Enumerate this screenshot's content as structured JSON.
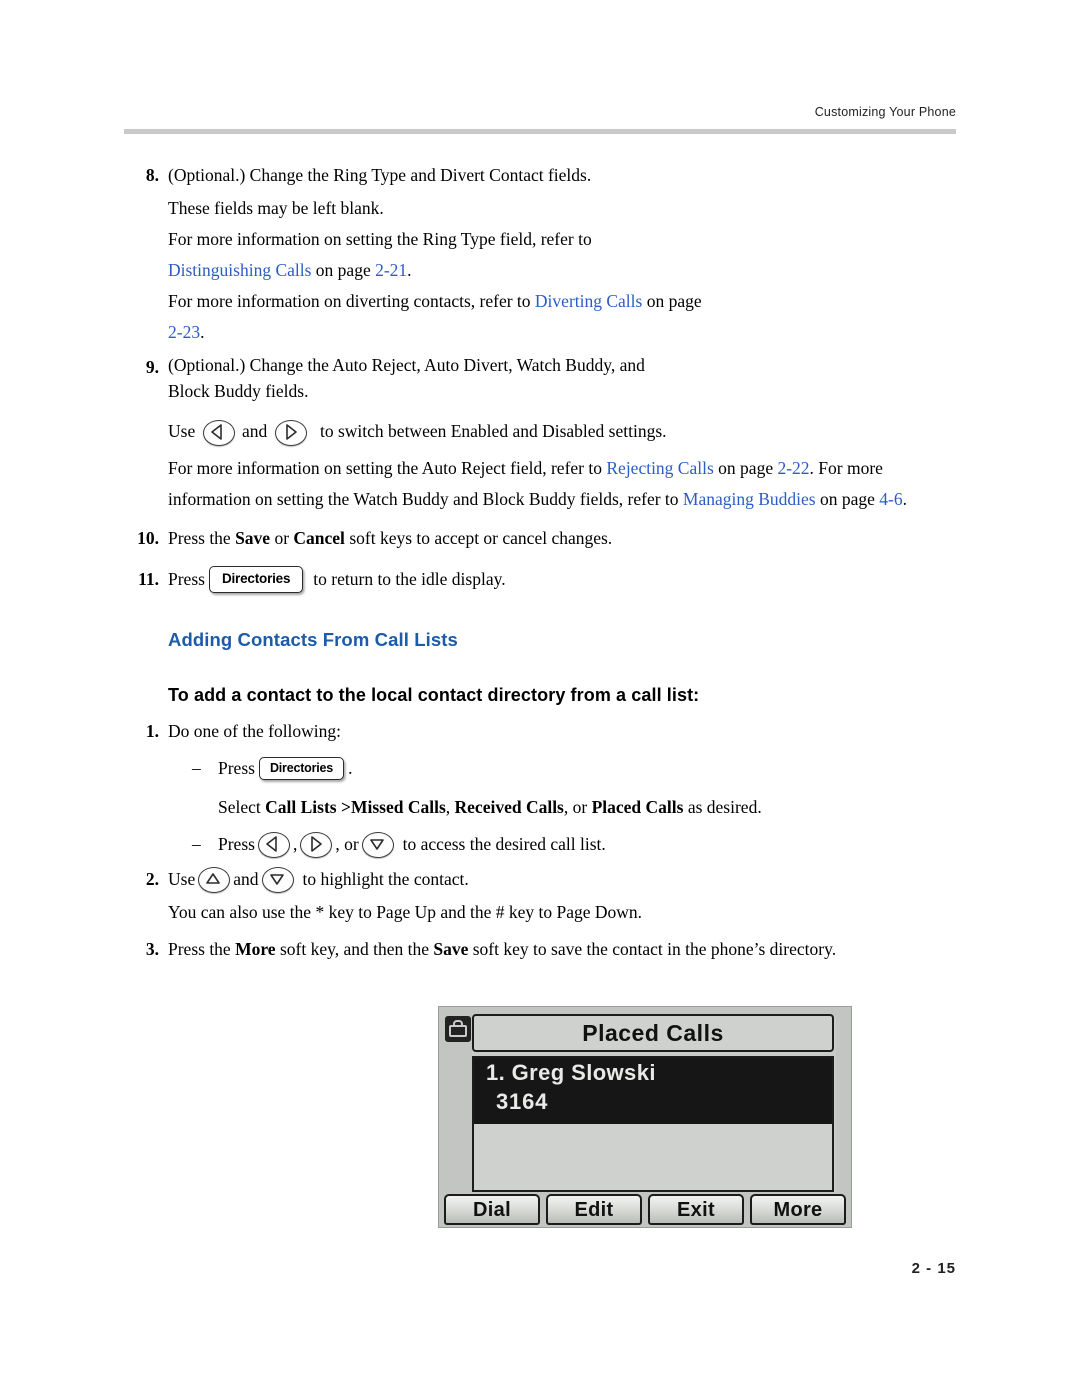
{
  "header": {
    "running_head": "Customizing Your Phone"
  },
  "footer": {
    "page_number": "2 - 15"
  },
  "steps": {
    "s8": {
      "num": "8.",
      "line1": "(Optional.) Change the Ring Type and Divert Contact fields.",
      "line2": "These fields may be left blank.",
      "line3a": "For more information on setting the Ring Type field, refer to ",
      "link1": "Distinguishing Calls",
      "line3b": " on page ",
      "link2": "2-21",
      "line3c": ".",
      "line4a": "For more information on diverting contacts, refer to ",
      "link3": "Diverting Calls",
      "line4b": " on page ",
      "link4": "2-23",
      "line4c": "."
    },
    "s9": {
      "num": "9.",
      "line1": "(Optional.) Change the Auto Reject, Auto Divert, Watch Buddy, and",
      "line2": "Block Buddy fields.",
      "use_label": "Use",
      "and_label": "and",
      "use_tail": "to switch between Enabled and Disabled settings.",
      "info_a": "For more information on setting the Auto Reject field, refer to ",
      "link_rejecting": "Rejecting Calls",
      "info_b": " on page ",
      "link_222": "2-22",
      "info_c": ". For more information on setting the Watch Buddy and Block Buddy fields, refer to ",
      "link_managing": "Managing Buddies",
      "info_d": " on page ",
      "link_46": "4-6",
      "info_e": "."
    },
    "s10": {
      "num": "10.",
      "pre": "Press the ",
      "save": "Save",
      "mid": " or ",
      "cancel": "Cancel",
      "post": " soft keys to accept or cancel changes."
    },
    "s11": {
      "num": "11.",
      "pre": "Press",
      "key": "Directories",
      "post": "to return to the idle display."
    }
  },
  "section": {
    "heading": "Adding Contacts From Call Lists",
    "subheading": "To add a contact to the local contact directory from a call list:"
  },
  "procedure": {
    "p1": {
      "num": "1.",
      "text": "Do one of the following:"
    },
    "dash1": {
      "mark": "–",
      "pre": "Press",
      "key": "Directories",
      "post": "."
    },
    "select_line": {
      "pre": "Select ",
      "b1": "Call Lists >Missed Calls",
      "sep1": ", ",
      "b2": "Received Calls",
      "sep2": ", or ",
      "b3": "Placed Calls",
      "post": " as desired."
    },
    "dash2": {
      "mark": "–",
      "pre": "Press",
      "comma1": ",",
      "comma2": ", or",
      "post": "to access the desired call list."
    },
    "p2": {
      "num": "2.",
      "use": "Use",
      "and": "and",
      "tail": "to highlight the contact.",
      "note": "You can also use the * key to Page Up and the # key to Page Down."
    },
    "p3": {
      "num": "3.",
      "pre": "Press the ",
      "more": "More",
      "mid": " soft key, and then the ",
      "save": "Save",
      "post": " soft key to save the contact in the phone’s directory."
    }
  },
  "phone_figure": {
    "title": "Placed Calls",
    "entry_name": "1. Greg Slowski",
    "entry_number": "3164",
    "softkeys": [
      "Dial",
      "Edit",
      "Exit",
      "More"
    ]
  }
}
